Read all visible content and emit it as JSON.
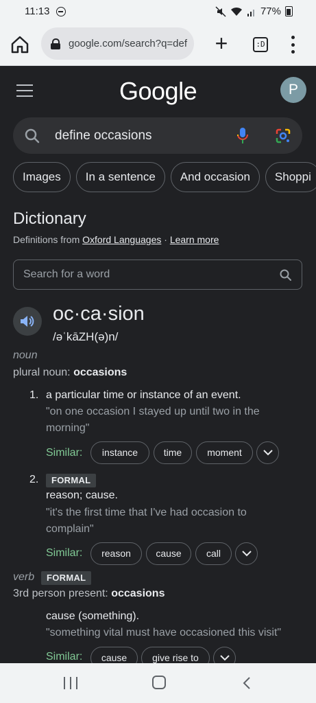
{
  "status": {
    "time": "11:13",
    "battery": "77%"
  },
  "browser": {
    "url": "google.com/search?q=def",
    "tabs_label": ":D"
  },
  "google": {
    "logo": "Google",
    "avatar_letter": "P",
    "query": "define occasions"
  },
  "chips": [
    "Images",
    "In a sentence",
    "And occasion",
    "Shoppi"
  ],
  "dictionary": {
    "title": "Dictionary",
    "source_prefix": "Definitions from ",
    "source_name": "Oxford Languages",
    "separator": " · ",
    "learn_more": "Learn more",
    "search_placeholder": "Search for a word",
    "headword": "oc·ca·sion",
    "phonetic": "/əˈkāZH(ə)n/",
    "noun": {
      "pos": "noun",
      "plural_label": "plural noun: ",
      "plural_value": "occasions",
      "senses": [
        {
          "num": "1.",
          "definition": "a particular time or instance of an event.",
          "example": "\"on one occasion I stayed up until two in the morning\"",
          "similar_label": "Similar:",
          "similar": [
            "instance",
            "time",
            "moment"
          ]
        },
        {
          "num": "2.",
          "badge": "FORMAL",
          "definition": "reason; cause.",
          "example": "\"it's the first time that I've had occasion to complain\"",
          "similar_label": "Similar:",
          "similar": [
            "reason",
            "cause",
            "call"
          ]
        }
      ]
    },
    "verb": {
      "pos": "verb",
      "badge": "FORMAL",
      "person_label": "3rd person present: ",
      "person_value": "occasions",
      "definition": "cause (something).",
      "example": "\"something vital must have occasioned this visit\"",
      "similar_label": "Similar:",
      "similar": [
        "cause",
        "give rise to"
      ]
    }
  },
  "icons": {
    "home": "home-icon",
    "lock": "lock-icon",
    "plus": "new-tab-icon",
    "tabs": "tab-switcher-icon",
    "menu": "more-vert-icon",
    "hamburger": "menu-icon",
    "search": "search-icon",
    "mic": "mic-icon",
    "lens": "google-lens-icon",
    "speaker": "speaker-icon",
    "chevron": "chevron-down-icon"
  }
}
